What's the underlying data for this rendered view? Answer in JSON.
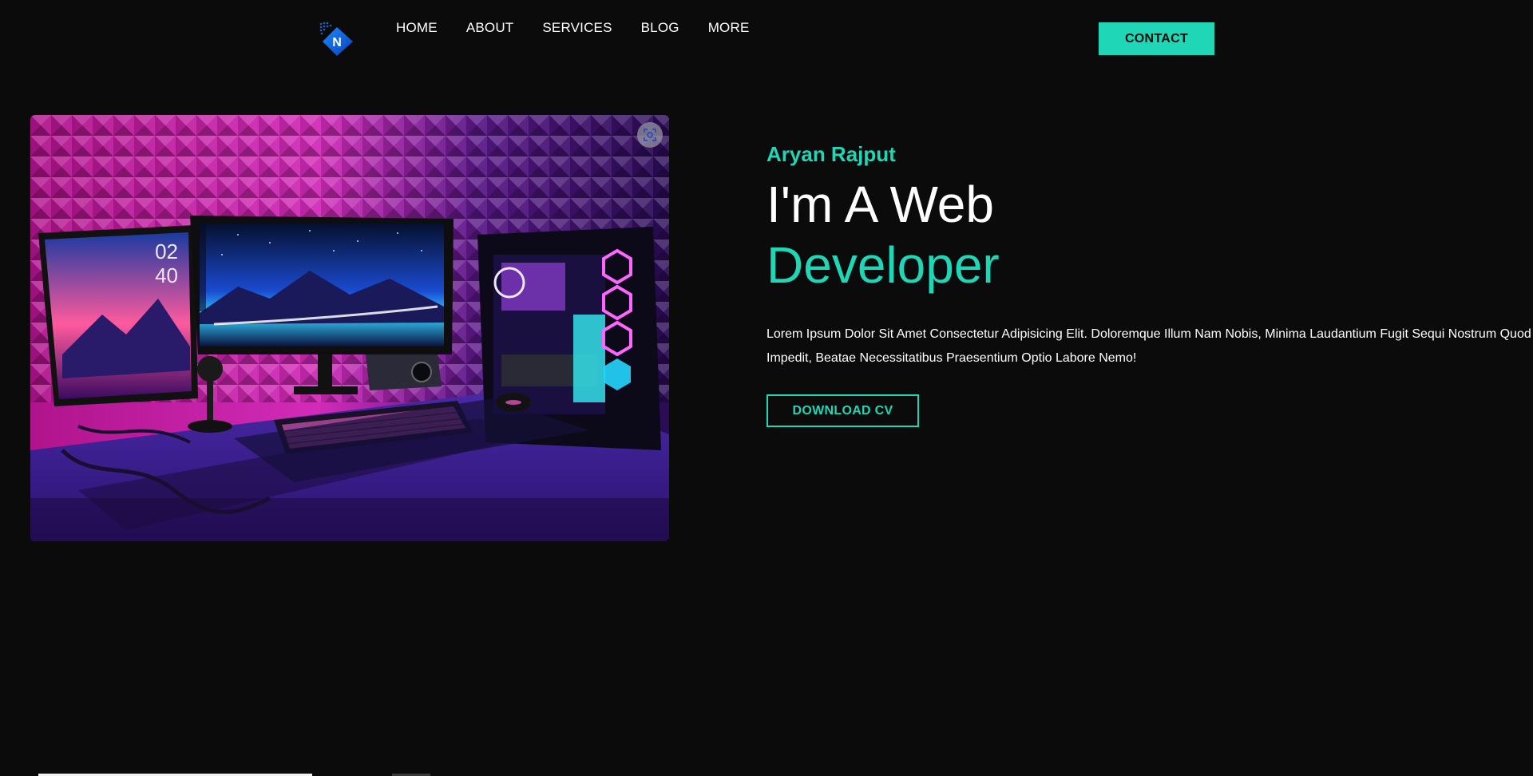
{
  "header": {
    "nav": [
      "HOME",
      "ABOUT",
      "SERVICES",
      "BLOG",
      "MORE"
    ],
    "contact_label": "CONTACT",
    "logo_letter": "N"
  },
  "hero": {
    "name": "Aryan Rajput",
    "headline_line1": "I'm A Web",
    "headline_line2": "Developer",
    "description": "Lorem Ipsum Dolor Sit Amet Consectetur Adipisicing Elit. Doloremque Illum Nam Nobis, Minima Laudantium Fugit Sequi Nostrum Quod Impedit, Beatae Necessitatibus Praesentium Optio Labore Nemo!",
    "download_label": "DOWNLOAD CV",
    "image_icon": "lens-search-icon",
    "monitor_clock": [
      "02",
      "40"
    ]
  },
  "colors": {
    "accent": "#1fd6b6",
    "background": "#0b0b0b"
  }
}
